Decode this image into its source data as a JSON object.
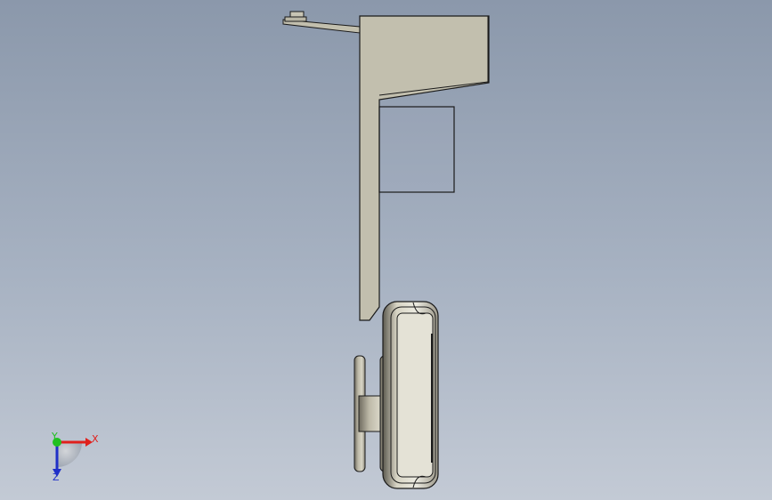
{
  "triad": {
    "x_label": "X",
    "y_label": "Y",
    "z_label": "Z",
    "x_color": "#e0201c",
    "y_color": "#20c020",
    "z_color": "#2030c8"
  },
  "colors": {
    "background_top": "#8b98ab",
    "background_bottom": "#c3cad5",
    "part_fill": "#c2bfae",
    "part_edge": "#1a1a1a",
    "hub_fill": "#a6a192"
  }
}
